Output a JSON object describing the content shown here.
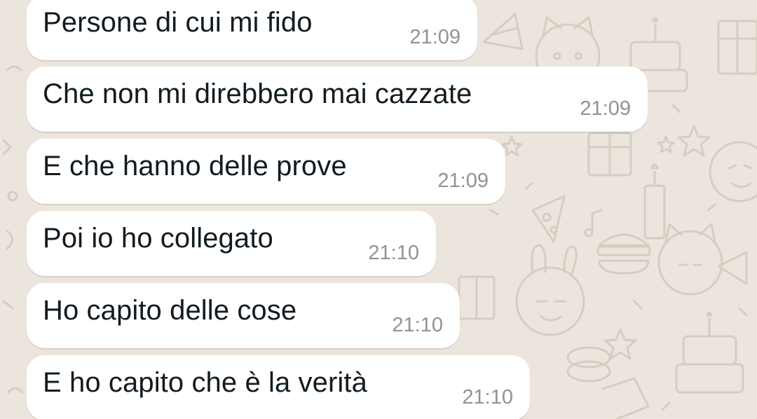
{
  "messages": [
    {
      "text": "Persone di cui mi fido",
      "time": "21:09"
    },
    {
      "text": "Che non mi direbbero mai cazzate",
      "time": "21:09"
    },
    {
      "text": "E che hanno delle prove",
      "time": "21:09"
    },
    {
      "text": "Poi io ho collegato",
      "time": "21:10"
    },
    {
      "text": "Ho capito delle cose",
      "time": "21:10"
    },
    {
      "text": "E ho capito che è la verità",
      "time": "21:10"
    }
  ],
  "colors": {
    "background": "#ece5dd",
    "bubble": "#ffffff",
    "text": "#111b21",
    "timestamp": "#8c9498",
    "doodle": "#d4cbc0"
  }
}
